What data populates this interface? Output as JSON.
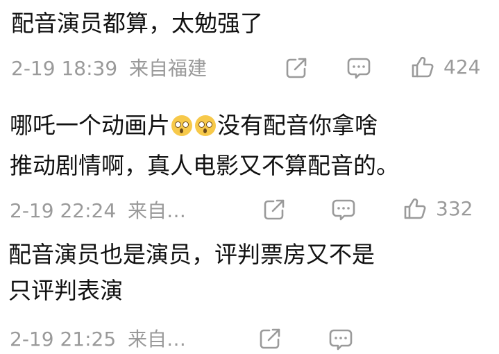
{
  "comments": [
    {
      "text": "配音演员都算，太勉强了",
      "time": "2-19 18:39",
      "location": "来自福建",
      "likes": "424"
    },
    {
      "text_part1": "哪吒一个动画片",
      "text_part2": "没有配音你拿啥",
      "text_line2": "推动剧情啊，真人电影又不算配音的。",
      "time": "2-19 22:24",
      "location": "来自…",
      "likes": "332"
    },
    {
      "text_line1": "配音演员也是演员，评判票房又不是",
      "text_line2": "只评判表演",
      "time": "2-19 21:25",
      "location": "来自…"
    }
  ],
  "icons": {
    "share": "share-icon",
    "comment": "comment-icon",
    "like": "thumbs-up-icon",
    "emoji": "astonished-face-emoji"
  },
  "colors": {
    "text": "#111111",
    "meta": "#9a9a9a",
    "background": "#ffffff"
  }
}
